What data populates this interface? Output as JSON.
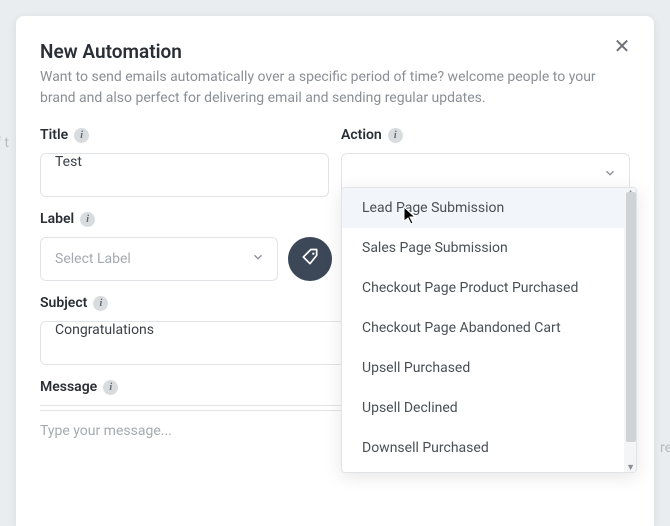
{
  "background": {
    "textLeft": "f t",
    "textRight": "re"
  },
  "modal": {
    "title": "New Automation",
    "subtitle": "Want to send emails automatically over a specific period of time? welcome people to your brand and also perfect for delivering email and sending regular updates.",
    "close": "✕"
  },
  "fields": {
    "title": {
      "label": "Title",
      "value": "Test"
    },
    "action": {
      "label": "Action",
      "value": ""
    },
    "label": {
      "label": "Label",
      "placeholder": "Select Label"
    },
    "subject": {
      "label": "Subject",
      "value": "Congratulations"
    },
    "message": {
      "label": "Message",
      "placeholder": "Type your message..."
    }
  },
  "dropdown": {
    "hoveredIndex": 0,
    "options": [
      "Lead Page Submission",
      "Sales Page Submission",
      "Checkout Page Product Purchased",
      "Checkout Page Abandoned Cart",
      "Upsell Purchased",
      "Upsell Declined",
      "Downsell Purchased"
    ]
  },
  "icons": {
    "info": "i"
  }
}
